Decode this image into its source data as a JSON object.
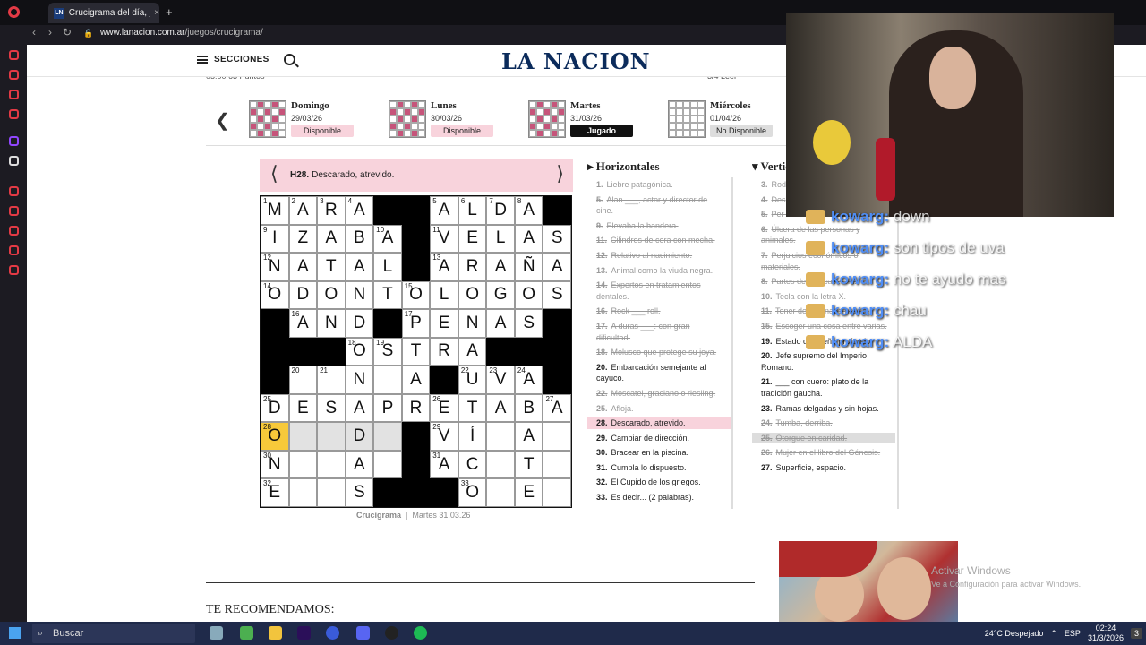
{
  "browser": {
    "tab_title": "Crucigrama del día, jugá o",
    "tab_favicon": "LN",
    "new_tab": "+",
    "close_tab": "×",
    "url_host": "www.lanacion.com.ar",
    "url_path": "/juegos/crucigrama/"
  },
  "site": {
    "menu_label": "SECCIONES",
    "logo": "LA NACION",
    "top_strip": "05:00   63 Puntos",
    "top_right": "3/4 Leer"
  },
  "days": [
    {
      "name": "Domingo",
      "date": "29/03/26",
      "status": "Disponible",
      "kind": "av"
    },
    {
      "name": "Lunes",
      "date": "30/03/26",
      "status": "Disponible",
      "kind": "av"
    },
    {
      "name": "Martes",
      "date": "31/03/26",
      "status": "Jugado",
      "kind": "pl"
    },
    {
      "name": "Miércoles",
      "date": "01/04/26",
      "status": "No Disponible",
      "kind": "na"
    }
  ],
  "current_clue": {
    "num": "H28.",
    "text": "Descarado, atrevido."
  },
  "grid": [
    [
      {
        "n": "1",
        "l": "M"
      },
      {
        "n": "2",
        "l": "A"
      },
      {
        "n": "3",
        "l": "R"
      },
      {
        "n": "4",
        "l": "A"
      },
      {
        "b": 1
      },
      {
        "b": 1
      },
      {
        "n": "5",
        "l": "A"
      },
      {
        "n": "6",
        "l": "L"
      },
      {
        "n": "7",
        "l": "D"
      },
      {
        "n": "8",
        "l": "A"
      }
    ],
    [
      {
        "n": "9",
        "l": "I"
      },
      {
        "l": "Z"
      },
      {
        "l": "A"
      },
      {
        "l": "B"
      },
      {
        "n": "10",
        "l": "A"
      },
      {
        "b": 1
      },
      {
        "n": "11",
        "l": "V"
      },
      {
        "l": "E"
      },
      {
        "l": "L"
      },
      {
        "l": "A"
      },
      {
        "l": "S"
      }
    ],
    [
      {
        "n": "12",
        "l": "N"
      },
      {
        "l": "A"
      },
      {
        "l": "T"
      },
      {
        "l": "A"
      },
      {
        "l": "L"
      },
      {
        "b": 1
      },
      {
        "n": "13",
        "l": "A"
      },
      {
        "l": "R"
      },
      {
        "l": "A"
      },
      {
        "l": "Ñ"
      },
      {
        "l": "A"
      }
    ],
    [
      {
        "n": "14",
        "l": "O"
      },
      {
        "l": "D"
      },
      {
        "l": "O"
      },
      {
        "l": "N"
      },
      {
        "l": "T"
      },
      {
        "n": "15",
        "l": "O"
      },
      {
        "l": "L"
      },
      {
        "l": "O"
      },
      {
        "l": "G"
      },
      {
        "l": "O"
      },
      {
        "l": "S"
      }
    ],
    [
      {
        "b": 1
      },
      {
        "n": "16",
        "l": "A"
      },
      {
        "l": "N"
      },
      {
        "l": "D"
      },
      {
        "b": 1
      },
      {
        "n": "17",
        "l": "P"
      },
      {
        "l": "E"
      },
      {
        "l": "N"
      },
      {
        "l": "A"
      },
      {
        "l": "S"
      },
      {
        "b": 1
      }
    ],
    [
      {
        "b": 1
      },
      {
        "b": 1
      },
      {
        "b": 1
      },
      {
        "n": "18",
        "l": "O"
      },
      {
        "n": "19",
        "l": "S"
      },
      {
        "l": "T"
      },
      {
        "l": "R"
      },
      {
        "l": "A"
      },
      {
        "b": 1
      },
      {
        "b": 1
      },
      {
        "b": 1
      }
    ],
    [
      {
        "b": 1
      },
      {
        "n": "20",
        "l": ""
      },
      {
        "n": "21",
        "l": ""
      },
      {
        "l": "N"
      },
      {
        "l": ""
      },
      {
        "l": "A"
      },
      {
        "b": 1
      },
      {
        "n": "22",
        "l": "U"
      },
      {
        "n": "23",
        "l": "V"
      },
      {
        "n": "24",
        "l": "A"
      },
      {
        "b": 1
      }
    ],
    [
      {
        "n": "25",
        "l": "D"
      },
      {
        "l": "E"
      },
      {
        "l": "S"
      },
      {
        "l": "A"
      },
      {
        "l": "P"
      },
      {
        "l": "R"
      },
      {
        "n": "26",
        "l": "E"
      },
      {
        "l": "T"
      },
      {
        "l": "A"
      },
      {
        "l": "B"
      },
      {
        "n": "27",
        "l": "A"
      }
    ],
    [
      {
        "n": "28",
        "l": "O",
        "s": "sel"
      },
      {
        "l": "",
        "s": "hl"
      },
      {
        "l": "",
        "s": "hl"
      },
      {
        "l": "D",
        "s": "hl"
      },
      {
        "l": "",
        "s": "hl"
      },
      {
        "b": 1
      },
      {
        "n": "29",
        "l": "V"
      },
      {
        "l": "Í"
      },
      {
        "l": ""
      },
      {
        "l": "A"
      },
      {
        "l": ""
      }
    ],
    [
      {
        "n": "30",
        "l": "N"
      },
      {
        "l": ""
      },
      {
        "l": ""
      },
      {
        "l": "A"
      },
      {
        "l": ""
      },
      {
        "b": 1
      },
      {
        "n": "31",
        "l": "A"
      },
      {
        "l": "C"
      },
      {
        "l": ""
      },
      {
        "l": "T"
      },
      {
        "l": ""
      }
    ],
    [
      {
        "n": "32",
        "l": "E"
      },
      {
        "l": ""
      },
      {
        "l": ""
      },
      {
        "l": "S"
      },
      {
        "b": 1
      },
      {
        "b": 1
      },
      {
        "b": 1
      },
      {
        "n": "33",
        "l": "O"
      },
      {
        "l": ""
      },
      {
        "l": "E"
      },
      {
        "l": ""
      }
    ]
  ],
  "caption": {
    "name": "Crucigrama",
    "date": "Martes 31.03.26"
  },
  "horizontal": {
    "title": "Horizontales",
    "clues": [
      {
        "num": "1.",
        "text": "Liebre patagónica.",
        "state": "done"
      },
      {
        "num": "5.",
        "text": "Alan ___, actor y director de cine.",
        "state": "done"
      },
      {
        "num": "9.",
        "text": "Elevaba la bandera.",
        "state": "done"
      },
      {
        "num": "11.",
        "text": "Cilindros de cera con mecha.",
        "state": "done"
      },
      {
        "num": "12.",
        "text": "Relativo al nacimiento.",
        "state": "done"
      },
      {
        "num": "13.",
        "text": "Animal como la viuda negra.",
        "state": "done"
      },
      {
        "num": "14.",
        "text": "Expertos en tratamientos dentales.",
        "state": "done"
      },
      {
        "num": "16.",
        "text": "Rock ___ roll.",
        "state": "done"
      },
      {
        "num": "17.",
        "text": "A duras ___: con gran dificultad.",
        "state": "done"
      },
      {
        "num": "18.",
        "text": "Molusco que protege su joya.",
        "state": "done"
      },
      {
        "num": "20.",
        "text": "Embarcación semejante al cayuco.",
        "state": ""
      },
      {
        "num": "22.",
        "text": "Moscatel, graciano o riesling.",
        "state": "done"
      },
      {
        "num": "25.",
        "text": "Afloja.",
        "state": "done"
      },
      {
        "num": "28.",
        "text": "Descarado, atrevido.",
        "state": "cur"
      },
      {
        "num": "29.",
        "text": "Cambiar de dirección.",
        "state": ""
      },
      {
        "num": "30.",
        "text": "Bracear en la piscina.",
        "state": ""
      },
      {
        "num": "31.",
        "text": "Cumpla lo dispuesto.",
        "state": ""
      },
      {
        "num": "32.",
        "text": "El Cupido de los griegos.",
        "state": ""
      },
      {
        "num": "33.",
        "text": "Es decir... (2 palabras).",
        "state": ""
      }
    ]
  },
  "vertical": {
    "title": "Verticales",
    "clues": [
      {
        "num": "3.",
        "text": "Rod",
        "state": "done"
      },
      {
        "num": "4.",
        "text": "Des",
        "state": "done"
      },
      {
        "num": "5.",
        "text": "Per aérea.",
        "state": "done"
      },
      {
        "num": "6.",
        "text": "Úlcera de las personas y animales.",
        "state": "done"
      },
      {
        "num": "7.",
        "text": "Perjuicios económicos o materiales.",
        "state": "done"
      },
      {
        "num": "8.",
        "text": "Partes de una cacerola.",
        "state": "done"
      },
      {
        "num": "10.",
        "text": "Tecla con la letra X.",
        "state": "done"
      },
      {
        "num": "11.",
        "text": "Tener determinado precio.",
        "state": "done"
      },
      {
        "num": "15.",
        "text": "Escoger una cosa entre varias.",
        "state": "done"
      },
      {
        "num": "19.",
        "text": "Estado de sueño profundo.",
        "state": ""
      },
      {
        "num": "20.",
        "text": "Jefe supremo del Imperio Romano.",
        "state": ""
      },
      {
        "num": "21.",
        "text": "___ con cuero: plato de la tradición gaucha.",
        "state": ""
      },
      {
        "num": "23.",
        "text": "Ramas delgadas y sin hojas.",
        "state": ""
      },
      {
        "num": "24.",
        "text": "Tumba, derriba.",
        "state": "done"
      },
      {
        "num": "25.",
        "text": "Otorgue en caridad.",
        "state": "gray"
      },
      {
        "num": "26.",
        "text": "Mujer en el libro del Génesis.",
        "state": "done"
      },
      {
        "num": "27.",
        "text": "Superficie, espacio.",
        "state": ""
      }
    ]
  },
  "recommend": "TE RECOMENDAMOS:",
  "chat": [
    {
      "user": "kowarg:",
      "msg": "down"
    },
    {
      "user": "kowarg:",
      "msg": "son tipos de uva"
    },
    {
      "user": "kowarg:",
      "msg": "no te ayudo mas"
    },
    {
      "user": "kowarg:",
      "msg": "chau"
    },
    {
      "user": "kowarg:",
      "msg": "ALDA"
    }
  ],
  "windows_mark": {
    "line1": "Activar Windows",
    "line2": "Ve a Configuración para activar Windows."
  },
  "taskbar": {
    "search": "Buscar",
    "weather": "24°C  Despejado",
    "lang": "ESP",
    "time": "02:24",
    "date": "31/3/2026",
    "notif": "3"
  }
}
